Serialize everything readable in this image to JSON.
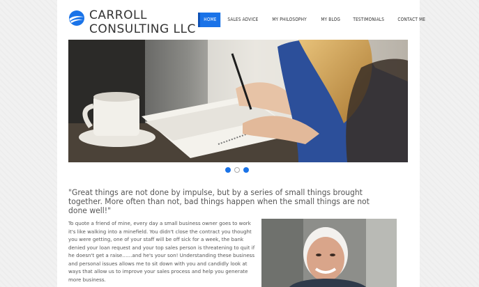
{
  "brand": {
    "line1": "CARROLL",
    "line2": "CONSULTING LLC",
    "logo_icon": "globe-swoosh-icon",
    "accent": "#1a73e8"
  },
  "nav": {
    "items": [
      {
        "label": "HOME",
        "active": true
      },
      {
        "label": "SALES ADVICE",
        "active": false
      },
      {
        "label": "MY PHILOSOPHY",
        "active": false
      },
      {
        "label": "MY BLOG",
        "active": false
      },
      {
        "label": "TESTIMONIALS",
        "active": false
      },
      {
        "label": "CONTACT ME",
        "active": false
      }
    ]
  },
  "slider": {
    "slide_count": 3,
    "current_index": 1
  },
  "quote": "\"Great things are not done by impulse, but by a series of small things brought together. More often than not, bad things happen when the small things are not done well!\"",
  "intro_paragraph": "To quote a friend of mine, every day a small business owner goes to work it's like walking into a minefield. You didn't close the contract you thought you were getting, one of your staff will be off sick for a week, the bank denied your loan request and your top sales person is threatening to quit if he doesn't get a raise……and he's your son! Understanding these business and personal issues allows me to sit down with you and candidly look at ways that allow us to improve your sales process and help you generate more business."
}
